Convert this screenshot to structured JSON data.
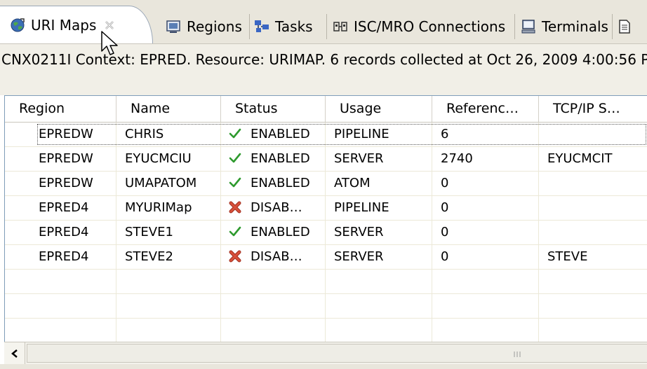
{
  "tabs": [
    {
      "label": "URI Maps",
      "icon": "globe-icon",
      "active": true,
      "closable": true
    },
    {
      "label": "Regions",
      "icon": "regions-icon"
    },
    {
      "label": "Tasks",
      "icon": "tasks-icon"
    },
    {
      "label": "ISC/MRO Connections",
      "icon": "connections-icon"
    },
    {
      "label": "Terminals",
      "icon": "terminal-icon"
    },
    {
      "label": "",
      "icon": "document-icon"
    }
  ],
  "status_message": "CNX0211I Context: EPRED. Resource: URIMAP. 6 records collected at Oct 26, 2009 4:00:56 P",
  "table": {
    "columns": [
      "Region",
      "Name",
      "Status",
      "Usage",
      "Referenc…",
      "TCP/IP S…"
    ],
    "rows": [
      {
        "region": "EPREDW",
        "name": "CHRIS",
        "status": "ENABLED",
        "status_icon": "check-icon",
        "usage": "PIPELINE",
        "references": "6",
        "tcpip": ""
      },
      {
        "region": "EPREDW",
        "name": "EYUCMCIU",
        "status": "ENABLED",
        "status_icon": "check-icon",
        "usage": "SERVER",
        "references": "2740",
        "tcpip": "EYUCMCIT"
      },
      {
        "region": "EPREDW",
        "name": "UMAPATOM",
        "status": "ENABLED",
        "status_icon": "check-icon",
        "usage": "ATOM",
        "references": "0",
        "tcpip": ""
      },
      {
        "region": "EPRED4",
        "name": "MYURIMap",
        "status": "DISAB…",
        "status_icon": "x-icon",
        "usage": "PIPELINE",
        "references": "0",
        "tcpip": ""
      },
      {
        "region": "EPRED4",
        "name": "STEVE1",
        "status": "ENABLED",
        "status_icon": "check-icon",
        "usage": "SERVER",
        "references": "0",
        "tcpip": ""
      },
      {
        "region": "EPRED4",
        "name": "STEVE2",
        "status": "DISAB…",
        "status_icon": "x-icon",
        "usage": "SERVER",
        "references": "0",
        "tcpip": "STEVE"
      }
    ],
    "empty_rows": 4
  },
  "colors": {
    "enabled": "#2e9a2e",
    "disabled": "#d8503a",
    "tab_bar": "#e9e6dc",
    "border": "#7f9db9"
  }
}
